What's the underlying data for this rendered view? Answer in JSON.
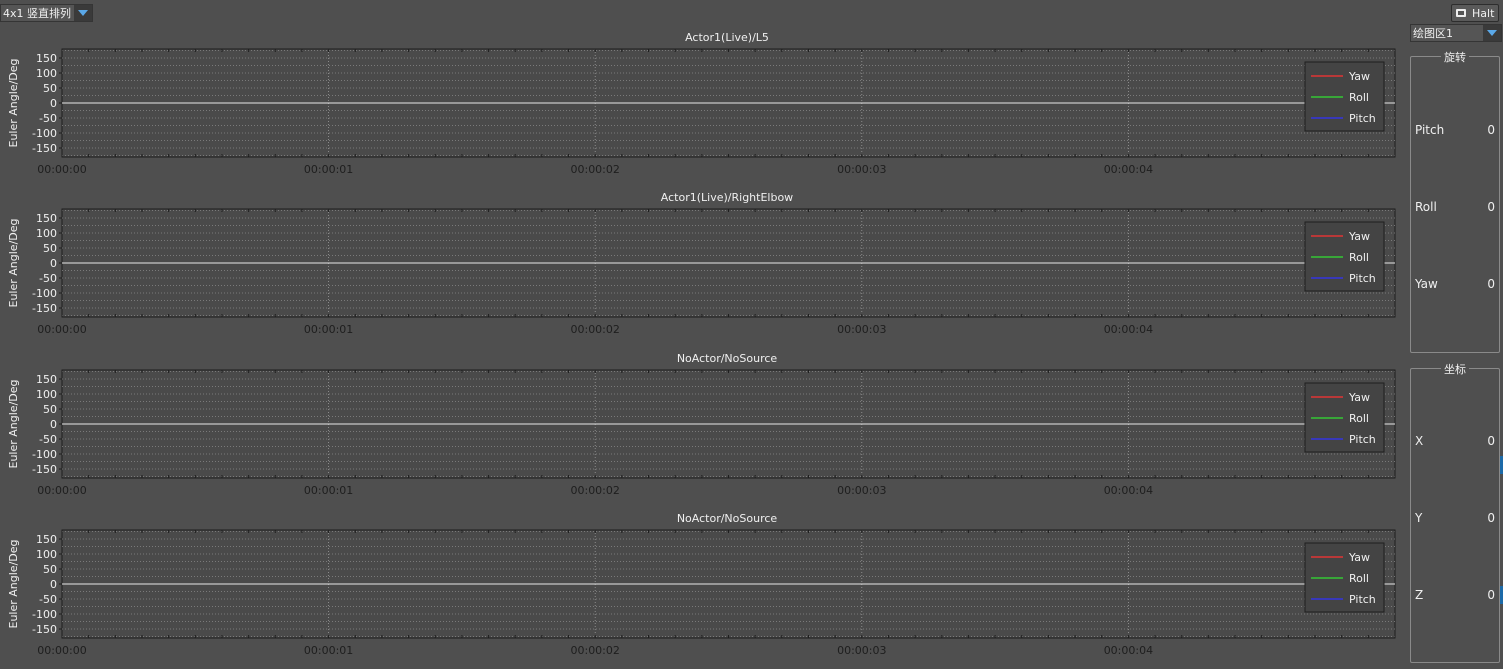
{
  "toolbar": {
    "layout_label": "4x1 竖直排列",
    "halt_label": "Halt"
  },
  "side": {
    "area_select": "绘图区1",
    "rotation": {
      "title": "旋转",
      "rows": [
        {
          "label": "Pitch",
          "value": "0"
        },
        {
          "label": "Roll",
          "value": "0"
        },
        {
          "label": "Yaw",
          "value": "0"
        }
      ]
    },
    "coords": {
      "title": "坐标",
      "rows": [
        {
          "label": "X",
          "value": "0"
        },
        {
          "label": "Y",
          "value": "0"
        },
        {
          "label": "Z",
          "value": "0"
        }
      ]
    }
  },
  "colors": {
    "yaw": "#ff3030",
    "roll": "#30e030",
    "pitch": "#3030ff",
    "plot_bg": "#4a4a4a",
    "grid": "#8a8a8a",
    "zero_line": "#e8e8e8"
  },
  "chart_data": [
    {
      "type": "line",
      "title": "Actor1(Live)/L5",
      "ylabel": "Euler Angle/Deg",
      "xlabel": "",
      "x_ticks": [
        "00:00:00",
        "00:00:01",
        "00:00:02",
        "00:00:03",
        "00:00:04"
      ],
      "y_ticks": [
        150,
        100,
        50,
        0,
        -50,
        -100,
        -150
      ],
      "ylim": [
        -180,
        180
      ],
      "xlim": [
        0,
        5
      ],
      "series": [
        {
          "name": "Yaw",
          "x": [
            0,
            5
          ],
          "y": [
            0,
            0
          ]
        },
        {
          "name": "Roll",
          "x": [
            0,
            5
          ],
          "y": [
            0,
            0
          ]
        },
        {
          "name": "Pitch",
          "x": [
            0,
            5
          ],
          "y": [
            0,
            0
          ]
        }
      ],
      "legend": "top-right",
      "grid": true
    },
    {
      "type": "line",
      "title": "Actor1(Live)/RightElbow",
      "ylabel": "Euler Angle/Deg",
      "xlabel": "",
      "x_ticks": [
        "00:00:00",
        "00:00:01",
        "00:00:02",
        "00:00:03",
        "00:00:04"
      ],
      "y_ticks": [
        150,
        100,
        50,
        0,
        -50,
        -100,
        -150
      ],
      "ylim": [
        -180,
        180
      ],
      "xlim": [
        0,
        5
      ],
      "series": [
        {
          "name": "Yaw",
          "x": [
            0,
            5
          ],
          "y": [
            0,
            0
          ]
        },
        {
          "name": "Roll",
          "x": [
            0,
            5
          ],
          "y": [
            0,
            0
          ]
        },
        {
          "name": "Pitch",
          "x": [
            0,
            5
          ],
          "y": [
            0,
            0
          ]
        }
      ],
      "legend": "top-right",
      "grid": true
    },
    {
      "type": "line",
      "title": "NoActor/NoSource",
      "ylabel": "Euler Angle/Deg",
      "xlabel": "",
      "x_ticks": [
        "00:00:00",
        "00:00:01",
        "00:00:02",
        "00:00:03",
        "00:00:04"
      ],
      "y_ticks": [
        150,
        100,
        50,
        0,
        -50,
        -100,
        -150
      ],
      "ylim": [
        -180,
        180
      ],
      "xlim": [
        0,
        5
      ],
      "series": [
        {
          "name": "Yaw",
          "x": [
            0,
            5
          ],
          "y": [
            0,
            0
          ]
        },
        {
          "name": "Roll",
          "x": [
            0,
            5
          ],
          "y": [
            0,
            0
          ]
        },
        {
          "name": "Pitch",
          "x": [
            0,
            5
          ],
          "y": [
            0,
            0
          ]
        }
      ],
      "legend": "top-right",
      "grid": true
    },
    {
      "type": "line",
      "title": "NoActor/NoSource",
      "ylabel": "Euler Angle/Deg",
      "xlabel": "",
      "x_ticks": [
        "00:00:00",
        "00:00:01",
        "00:00:02",
        "00:00:03",
        "00:00:04"
      ],
      "y_ticks": [
        150,
        100,
        50,
        0,
        -50,
        -100,
        -150
      ],
      "ylim": [
        -180,
        180
      ],
      "xlim": [
        0,
        5
      ],
      "series": [
        {
          "name": "Yaw",
          "x": [
            0,
            5
          ],
          "y": [
            0,
            0
          ]
        },
        {
          "name": "Roll",
          "x": [
            0,
            5
          ],
          "y": [
            0,
            0
          ]
        },
        {
          "name": "Pitch",
          "x": [
            0,
            5
          ],
          "y": [
            0,
            0
          ]
        }
      ],
      "legend": "top-right",
      "grid": true
    }
  ]
}
